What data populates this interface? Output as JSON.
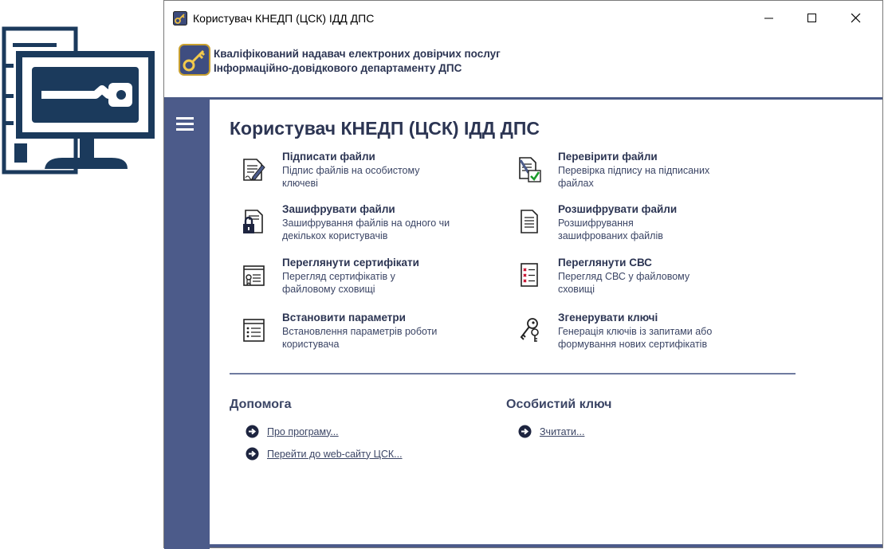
{
  "window": {
    "title": "Користувач КНЕДП (ЦСК) ІДД ДПС"
  },
  "banner": {
    "line1": "Кваліфікований надавач електроних довірчих послуг",
    "line2": "Інформаційно-довідкового департаменту ДПС"
  },
  "main": {
    "title": "Користувач КНЕДП (ЦСК) ІДД ДПС",
    "actions": [
      {
        "title": "Підписати файли",
        "desc": "Підпис файлів на особистому ключеві",
        "icon": "sign-file-icon"
      },
      {
        "title": "Перевірити файли",
        "desc": "Перевірка підпису на підписаних файлах",
        "icon": "verify-file-icon"
      },
      {
        "title": "Зашифрувати файли",
        "desc": "Зашифрування файлів на одного чи декількох користувачів",
        "icon": "encrypt-file-icon"
      },
      {
        "title": "Розшифрувати файли",
        "desc": "Розшифрування зашифрованих файлів",
        "icon": "decrypt-file-icon"
      },
      {
        "title": "Переглянути сертифікати",
        "desc": "Перегляд сертифікатів у файловому сховищі",
        "icon": "certificate-icon"
      },
      {
        "title": "Переглянути СВС",
        "desc": "Перегляд СВС у файловому сховищі",
        "icon": "revocation-list-icon"
      },
      {
        "title": "Встановити параметри",
        "desc": "Встановлення параметрів роботи користувача",
        "icon": "settings-list-icon"
      },
      {
        "title": "Згенерувати ключі",
        "desc": "Генерація ключів із запитами або формування нових сертифікатів",
        "icon": "keys-icon"
      }
    ]
  },
  "help": {
    "title": "Допомога",
    "links": [
      "Про програму...",
      "Перейти до web-сайту ЦСК..."
    ]
  },
  "private_key": {
    "title": "Особистий ключ",
    "links": [
      "Зчитати..."
    ]
  },
  "colors": {
    "accent": "#4c5b8a",
    "text": "#2c3553",
    "logo": "#1b3a5c"
  }
}
